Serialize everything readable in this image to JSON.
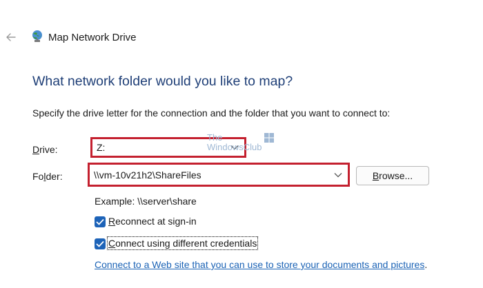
{
  "window": {
    "title": "Map Network Drive",
    "heading": "What network folder would you like to map?",
    "instruction": "Specify the drive letter for the connection and the folder that you want to connect to:"
  },
  "drive": {
    "label_pre": "",
    "label_accel": "D",
    "label_post": "rive:",
    "value": "Z:"
  },
  "folder": {
    "label_pre": "Fo",
    "label_accel": "l",
    "label_post": "der:",
    "value": "\\\\vm-10v21h2\\ShareFiles"
  },
  "browse": {
    "label_accel": "B",
    "label_post": "rowse..."
  },
  "example": "Example: \\\\server\\share",
  "options": {
    "reconnect": {
      "accel": "R",
      "rest": "econnect at sign-in",
      "checked": true
    },
    "credentials": {
      "pre": "",
      "accel": "C",
      "rest": "onnect using different credentials",
      "checked": true
    }
  },
  "link": "Connect to a Web site that you can use to store your documents and pictures",
  "link_end": ".",
  "watermark": {
    "line1": "The",
    "line2": "WindowsClub"
  },
  "colors": {
    "accent": "#1d63b8",
    "highlight_border": "#c4202f",
    "heading": "#1f3f77",
    "link": "#1a62b5"
  }
}
